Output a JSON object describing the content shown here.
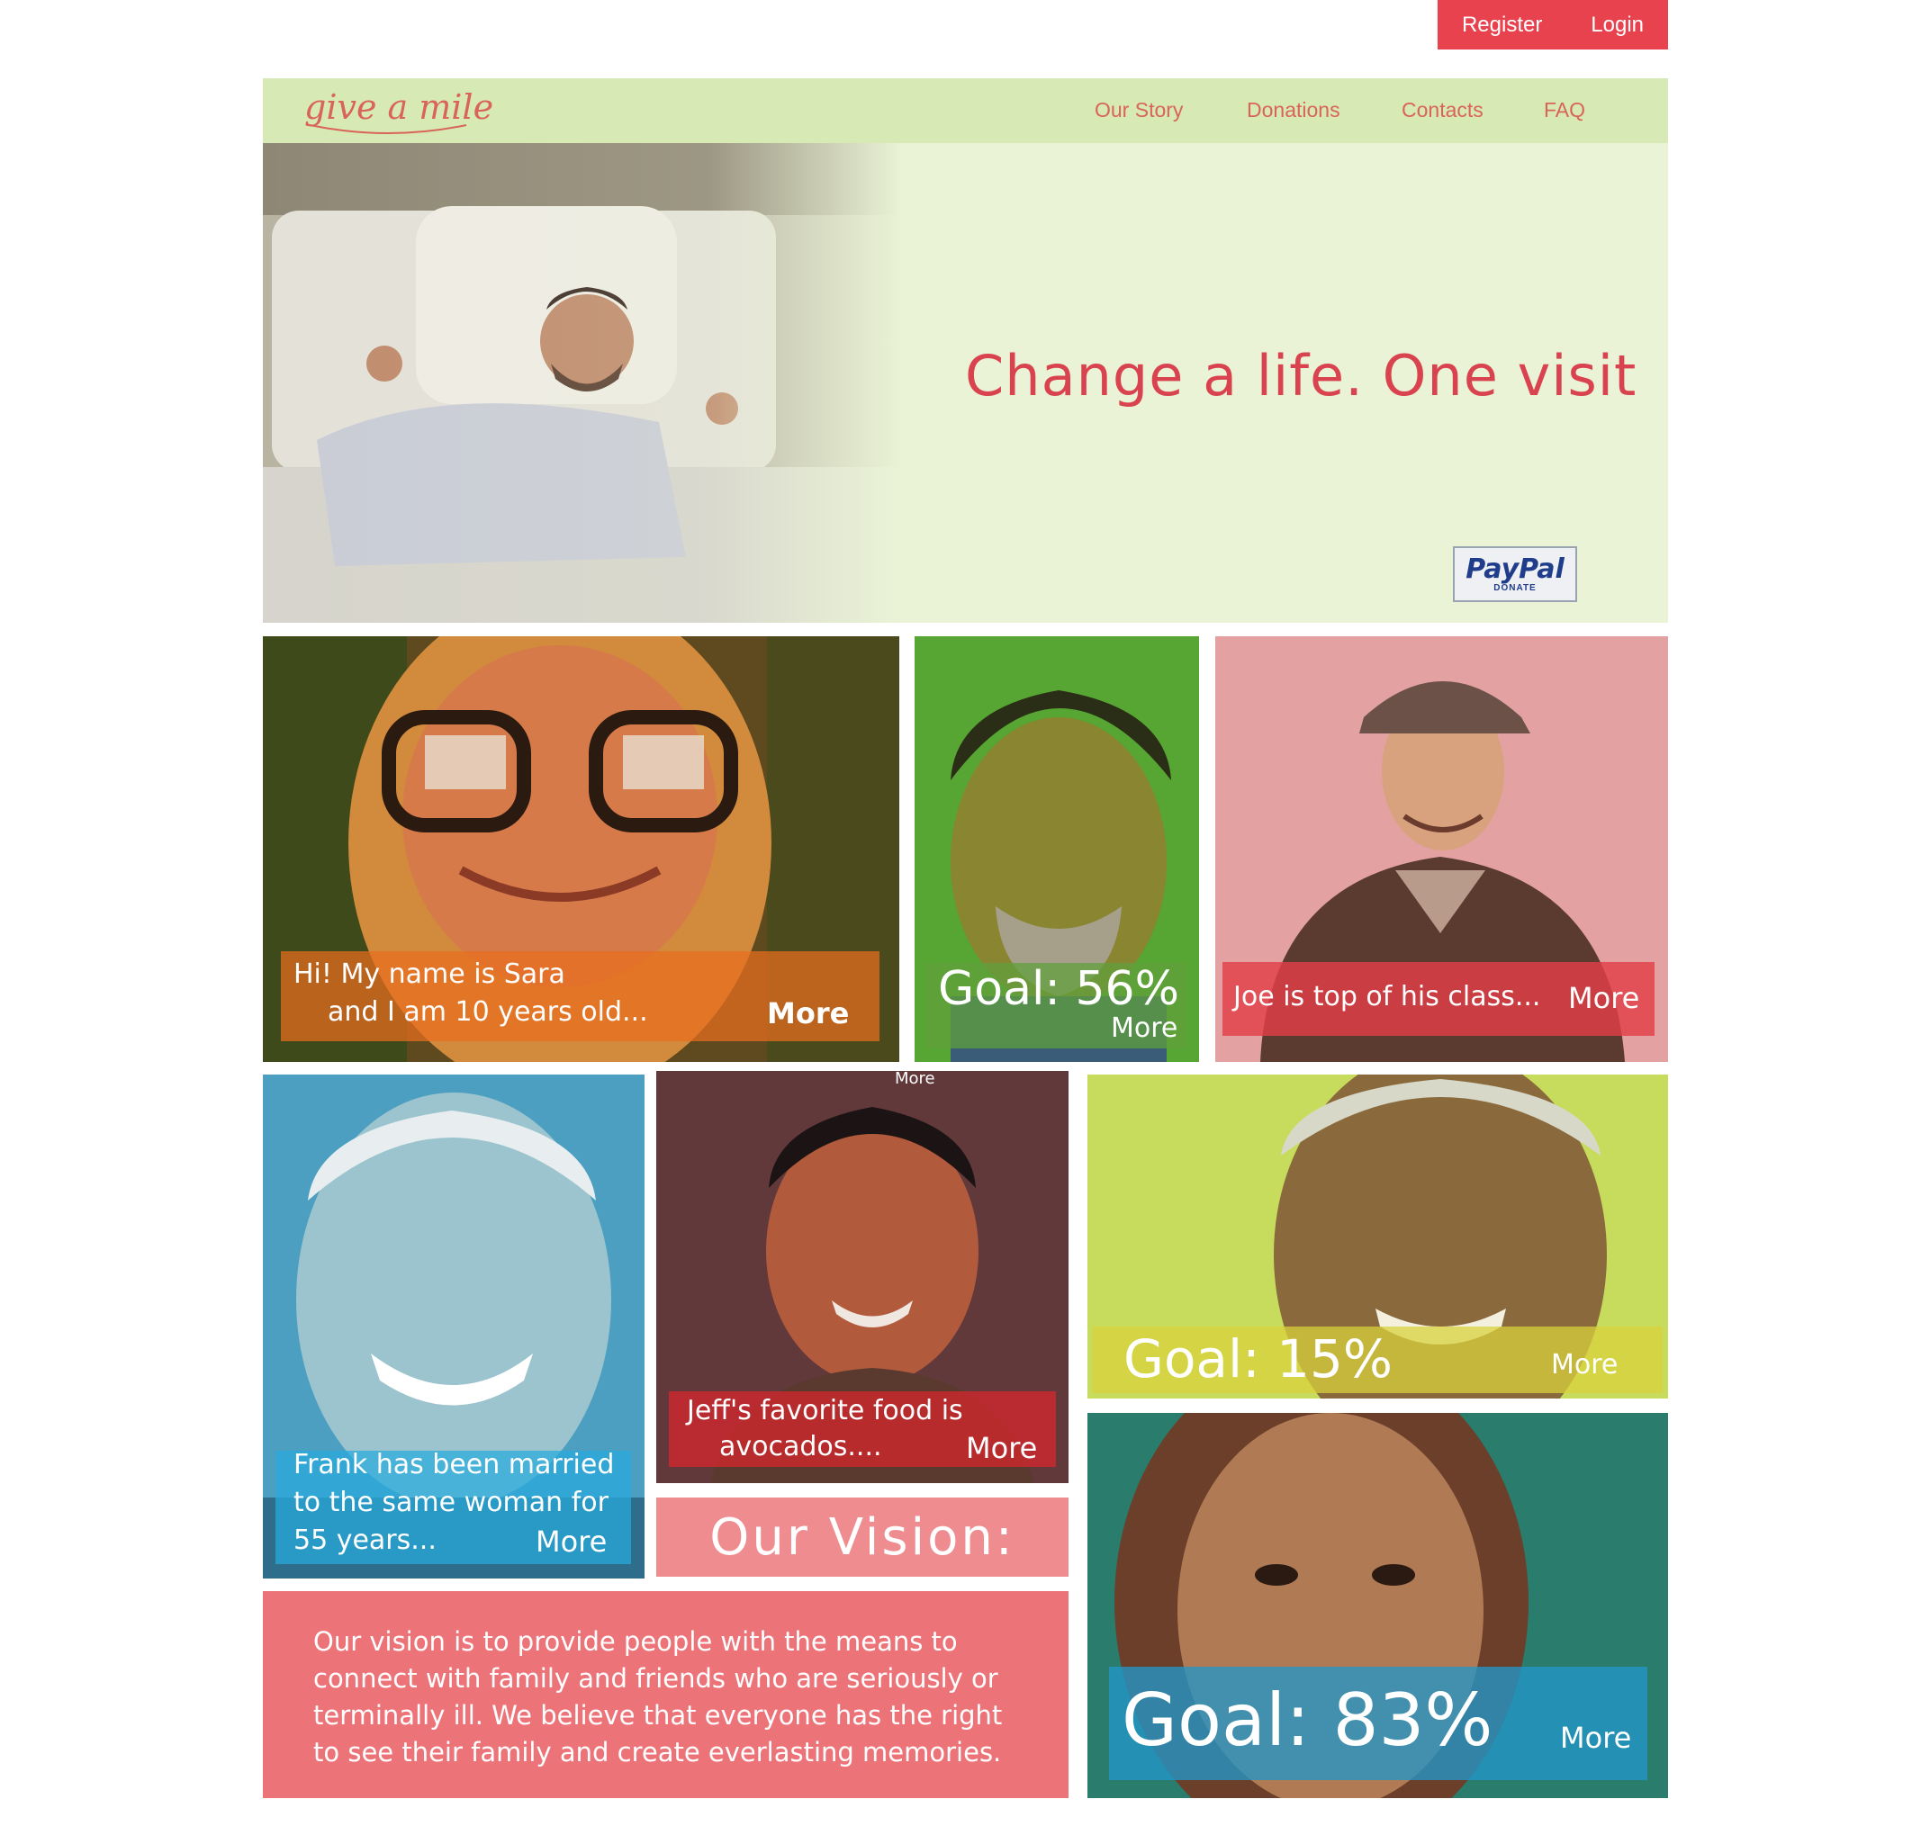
{
  "auth": {
    "register": "Register",
    "login": "Login"
  },
  "nav": {
    "logo": "give a mile",
    "links": [
      "Our Story",
      "Donations",
      "Contacts",
      "FAQ"
    ]
  },
  "hero": {
    "headline": "Change a life. One visit",
    "paypal_brand": "PayPal",
    "paypal_sub": "DONATE"
  },
  "tiles": {
    "sara": {
      "line1": "Hi! My name is Sara",
      "line2": "and I am 10 years old...",
      "more": "More"
    },
    "goal56": {
      "goal": "Goal: 56%",
      "more": "More"
    },
    "joe": {
      "caption": "Joe is top of his class...",
      "more": "More"
    },
    "frank": {
      "line1": "Frank has been married",
      "line2": "to the same woman for",
      "line3": "55 years...",
      "more": "More"
    },
    "jeff": {
      "top_more": "More",
      "line1": "Jeff's favorite food is",
      "line2": "avocados....",
      "more": "More"
    },
    "goal15": {
      "goal": "Goal: 15%",
      "more": "More"
    },
    "goal83": {
      "goal": "Goal: 83%",
      "more": "More"
    }
  },
  "vision": {
    "title": "Our Vision:",
    "text": "Our vision is to provide people with the means to connect with family and friends who are seriously or terminally ill. We believe that everyone has the right to see their family and create everlasting memories."
  }
}
